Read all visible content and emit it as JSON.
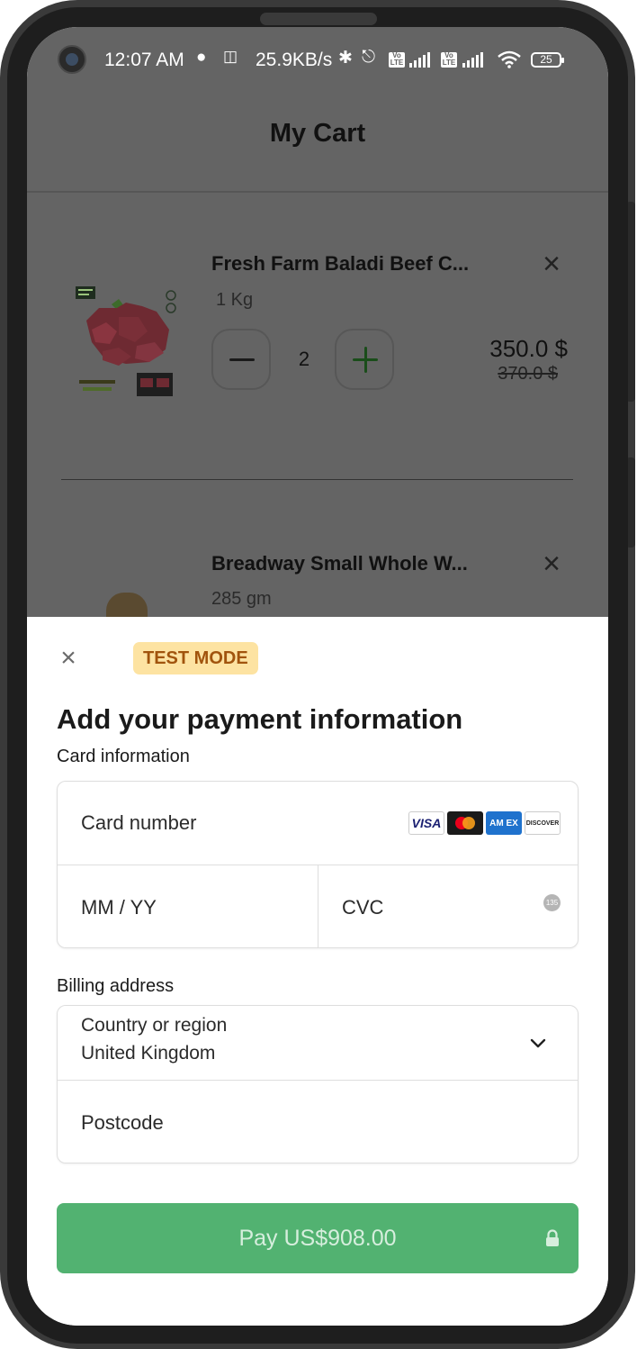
{
  "status_bar": {
    "time": "12:07 AM",
    "net_speed": "25.9KB/s",
    "battery": "25",
    "volte_label": "Vo\nLTE"
  },
  "app": {
    "title": "My Cart",
    "items": [
      {
        "name": "Fresh Farm Baladi Beef C...",
        "weight": "1 Kg",
        "quantity": "2",
        "price": "350.0 $",
        "old_price": "370.0 $",
        "image_icon": "beef-cubes-product-icon"
      },
      {
        "name": "Breadway Small Whole W...",
        "weight": "285 gm",
        "image_icon": "bread-product-icon"
      }
    ]
  },
  "payment_sheet": {
    "badge": "TEST MODE",
    "title": "Add your payment information",
    "card_section_label": "Card information",
    "card_number_placeholder": "Card number",
    "expiry_placeholder": "MM / YY",
    "cvc_placeholder": "CVC",
    "cvc_hint": "135",
    "brands": {
      "visa": "VISA",
      "amex": "AM EX",
      "discover": "DISCOVER"
    },
    "billing_section_label": "Billing address",
    "country_label": "Country or region",
    "country_value": "United Kingdom",
    "postcode_placeholder": "Postcode",
    "pay_button_label": "Pay US$908.00"
  },
  "colors": {
    "pay_button": "#52b271",
    "badge_bg": "#fde3a2",
    "badge_text": "#a1540d",
    "overlay": "#646464"
  }
}
